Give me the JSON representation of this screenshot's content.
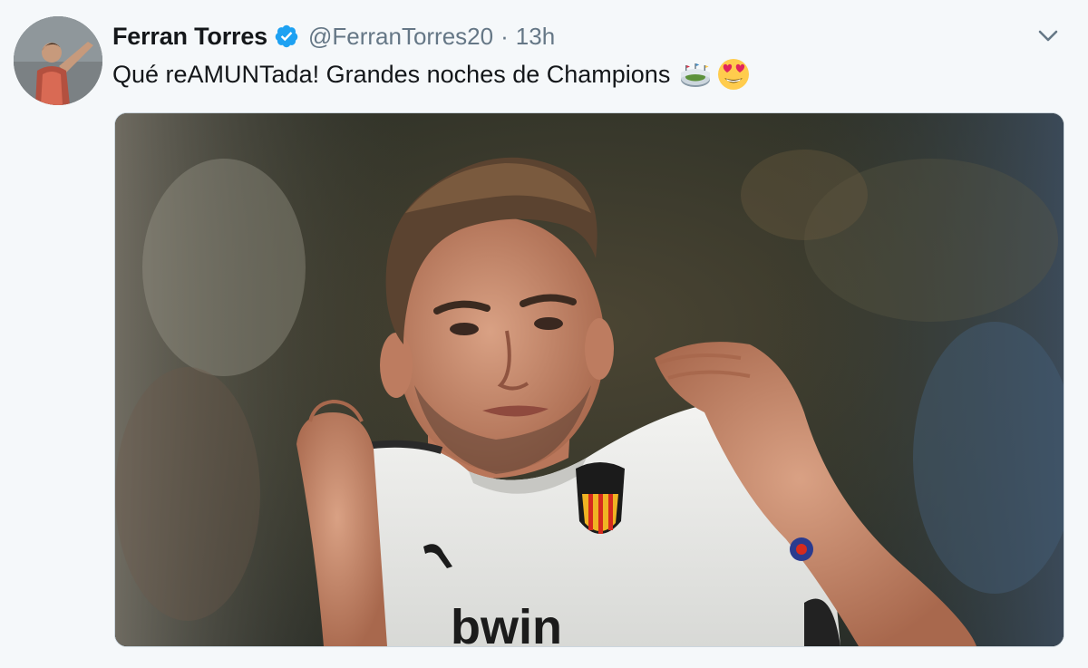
{
  "tweet": {
    "display_name": "Ferran Torres",
    "handle": "@FerranTorres20",
    "separator": "·",
    "time": "13h",
    "text": "Qué reAMUNTada! Grandes noches de Champions",
    "emojis": [
      "stadium-emoji",
      "heart-eyes-emoji"
    ],
    "verified": true
  },
  "media": {
    "photo_subject": "football player in white Valencia shirt holding up the crest",
    "shirt_sponsor_text": "bwin"
  },
  "colors": {
    "background": "#f5f8fa",
    "name_text": "#14171a",
    "secondary_text": "#657786",
    "verified_blue": "#1da1f2"
  }
}
